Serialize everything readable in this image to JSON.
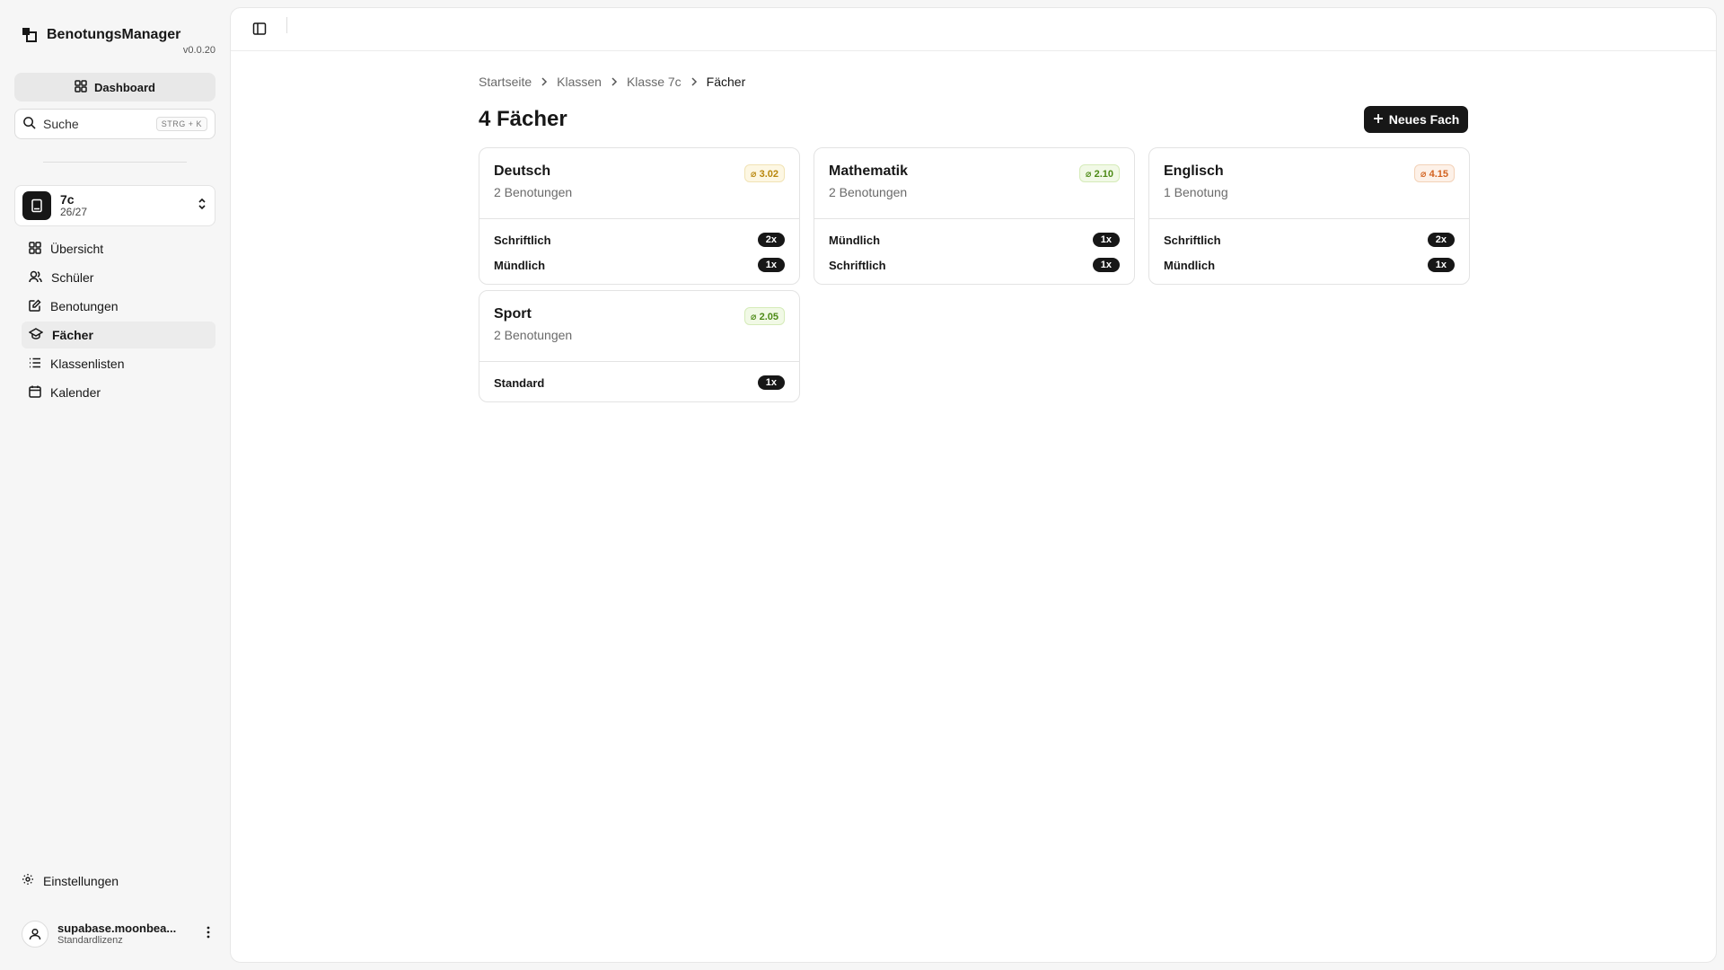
{
  "app": {
    "name": "BenotungsManager",
    "version": "v0.0.20"
  },
  "sidebar": {
    "dashboard_label": "Dashboard",
    "search": {
      "label": "Suche",
      "shortcut": "STRG + K"
    },
    "class_switcher": {
      "name": "7c",
      "year": "26/27"
    },
    "items": [
      {
        "label": "Übersicht",
        "icon": "grid-icon"
      },
      {
        "label": "Schüler",
        "icon": "users-icon"
      },
      {
        "label": "Benotungen",
        "icon": "edit-icon"
      },
      {
        "label": "Fächer",
        "icon": "graduation-cap-icon",
        "active": true
      },
      {
        "label": "Klassenlisten",
        "icon": "list-icon"
      },
      {
        "label": "Kalender",
        "icon": "calendar-icon"
      }
    ],
    "settings_label": "Einstellungen",
    "user": {
      "name": "supabase.moonbea...",
      "license": "Standardlizenz"
    }
  },
  "breadcrumb": [
    "Startseite",
    "Klassen",
    "Klasse 7c",
    "Fächer"
  ],
  "page": {
    "title": "4 Fächer",
    "new_button": "Neues Fach"
  },
  "subjects": [
    {
      "name": "Deutsch",
      "count": "2 Benotungen",
      "avg": "⌀ 3.02",
      "avg_color": "#b8860b",
      "avg_bg": "#fdf7e3",
      "avg_border": "#f1e3b5",
      "rows": [
        {
          "label": "Schriftlich",
          "count": "2x"
        },
        {
          "label": "Mündlich",
          "count": "1x"
        }
      ]
    },
    {
      "name": "Mathematik",
      "count": "2 Benotungen",
      "avg": "⌀ 2.10",
      "avg_color": "#4d8a16",
      "avg_bg": "#f1f9e6",
      "avg_border": "#d5ebb9",
      "rows": [
        {
          "label": "Mündlich",
          "count": "1x"
        },
        {
          "label": "Schriftlich",
          "count": "1x"
        }
      ]
    },
    {
      "name": "Englisch",
      "count": "1 Benotung",
      "avg": "⌀ 4.15",
      "avg_color": "#d2611e",
      "avg_bg": "#fdf1e8",
      "avg_border": "#f3d2b8",
      "rows": [
        {
          "label": "Schriftlich",
          "count": "2x"
        },
        {
          "label": "Mündlich",
          "count": "1x"
        }
      ]
    },
    {
      "name": "Sport",
      "count": "2 Benotungen",
      "avg": "⌀ 2.05",
      "avg_color": "#4d8a16",
      "avg_bg": "#f1f9e6",
      "avg_border": "#d5ebb9",
      "rows": [
        {
          "label": "Standard",
          "count": "1x"
        }
      ]
    }
  ]
}
